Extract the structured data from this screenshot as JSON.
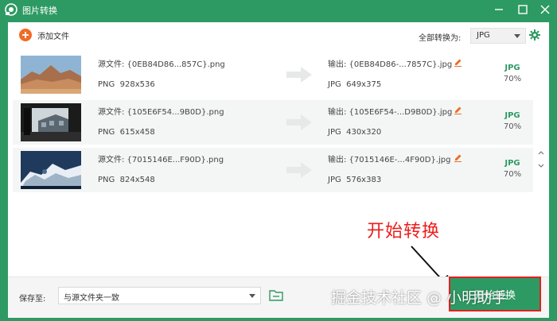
{
  "window": {
    "title": "图片转换"
  },
  "toolbar": {
    "add_label": "添加文件",
    "convert_all_label": "全部转换为:",
    "format_value": "JPG"
  },
  "files": [
    {
      "source_name": "源文件: {0EB84D86...857C}.png",
      "source_format": "PNG",
      "source_size": "928x536",
      "output_name": "输出: {0EB84D86-...7857C}.jpg",
      "output_format": "JPG",
      "output_size": "649x375",
      "badge": "JPG",
      "quality": "70%"
    },
    {
      "source_name": "源文件: {105E6F54...9B0D}.png",
      "source_format": "PNG",
      "source_size": "615x458",
      "output_name": "输出: {105E6F54-...D9B0D}.jpg",
      "output_format": "JPG",
      "output_size": "430x320",
      "badge": "JPG",
      "quality": "70%"
    },
    {
      "source_name": "源文件: {7015146E...F90D}.png",
      "source_format": "PNG",
      "source_size": "824x548",
      "output_name": "输出: {7015146E-...4F90D}.jpg",
      "output_format": "JPG",
      "output_size": "576x383",
      "badge": "JPG",
      "quality": "70%"
    }
  ],
  "footer": {
    "save_label": "保存至:",
    "save_value": "与源文件夹一致",
    "start_label": "开始转换"
  },
  "annotation": {
    "text": "开始转换"
  },
  "watermark": {
    "text": "掘金技术社区 @ 小明助手"
  },
  "colors": {
    "accent": "#2e9a63",
    "add_button": "#f16b26",
    "annotation": "#ee1c1c"
  }
}
